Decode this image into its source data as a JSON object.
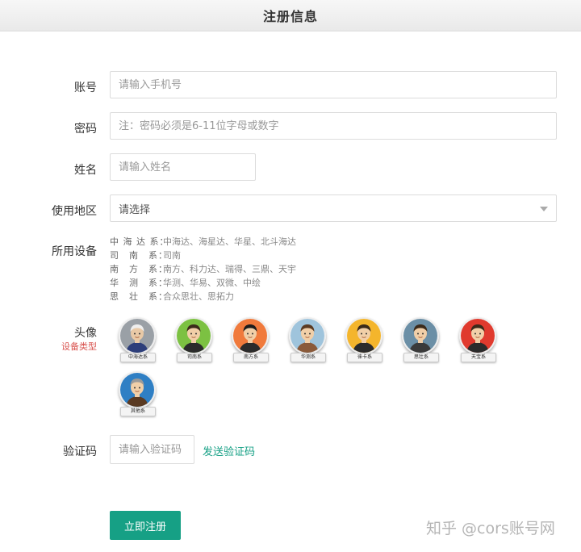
{
  "header": {
    "title": "注册信息"
  },
  "form": {
    "account_label": "账号",
    "account_placeholder": "请输入手机号",
    "password_label": "密码",
    "password_placeholder": "注：密码必须是6-11位字母或数字",
    "name_label": "姓名",
    "name_placeholder": "请输入姓名",
    "region_label": "使用地区",
    "region_value": "请选择",
    "devices_label": "所用设备",
    "devices": [
      {
        "series": "中 海 达 系：",
        "brands": "中海达、海星达、华星、北斗海达"
      },
      {
        "series": "司　南　系：",
        "brands": "司南"
      },
      {
        "series": "南　方　系：",
        "brands": "南方、科力达、瑞得、三鼎、天宇"
      },
      {
        "series": "华　测　系：",
        "brands": "华测、华易、双微、中绘"
      },
      {
        "series": "思　壮　系：",
        "brands": "合众思壮、思拓力"
      }
    ],
    "avatar_label": "头像",
    "avatar_sub_label": "设备类型",
    "avatars": [
      {
        "tag": "中海达系",
        "bg": "#9aa0a6",
        "skin": "#e9c9a6",
        "hair": "#eeeeee",
        "shirt": "#2d3e7a"
      },
      {
        "tag": "司南系",
        "bg": "#7cc142",
        "skin": "#f1cfa8",
        "hair": "#3b2a1a",
        "shirt": "#2b2b2b"
      },
      {
        "tag": "南方系",
        "bg": "#f07a3c",
        "skin": "#f1cfa8",
        "hair": "#1c1c1c",
        "shirt": "#2b2b2b"
      },
      {
        "tag": "华测系",
        "bg": "#9fc4dc",
        "skin": "#f1cfa8",
        "hair": "#5a3a22",
        "shirt": "#8a5a3a"
      },
      {
        "tag": "徕卡系",
        "bg": "#f4b52c",
        "skin": "#f1cfa8",
        "hair": "#3b2a1a",
        "shirt": "#2b2b2b"
      },
      {
        "tag": "思壮系",
        "bg": "#6b8fa6",
        "skin": "#f1cfa8",
        "hair": "#3b2a1a",
        "shirt": "#3a3a3a"
      },
      {
        "tag": "天宝系",
        "bg": "#e03a2e",
        "skin": "#f1cfa8",
        "hair": "#3b2a1a",
        "shirt": "#2b2b2b"
      },
      {
        "tag": "其他系",
        "bg": "#2f7fc4",
        "skin": "#f1cfa8",
        "hair": "#9a9a9a",
        "shirt": "#5a3a22"
      }
    ],
    "code_label": "验证码",
    "code_placeholder": "请输入验证码",
    "send_code": "发送验证码",
    "submit": "立即注册"
  },
  "watermark": "知乎 @cors账号网",
  "colors": {
    "accent": "#16a085",
    "required": "#d9534f"
  }
}
